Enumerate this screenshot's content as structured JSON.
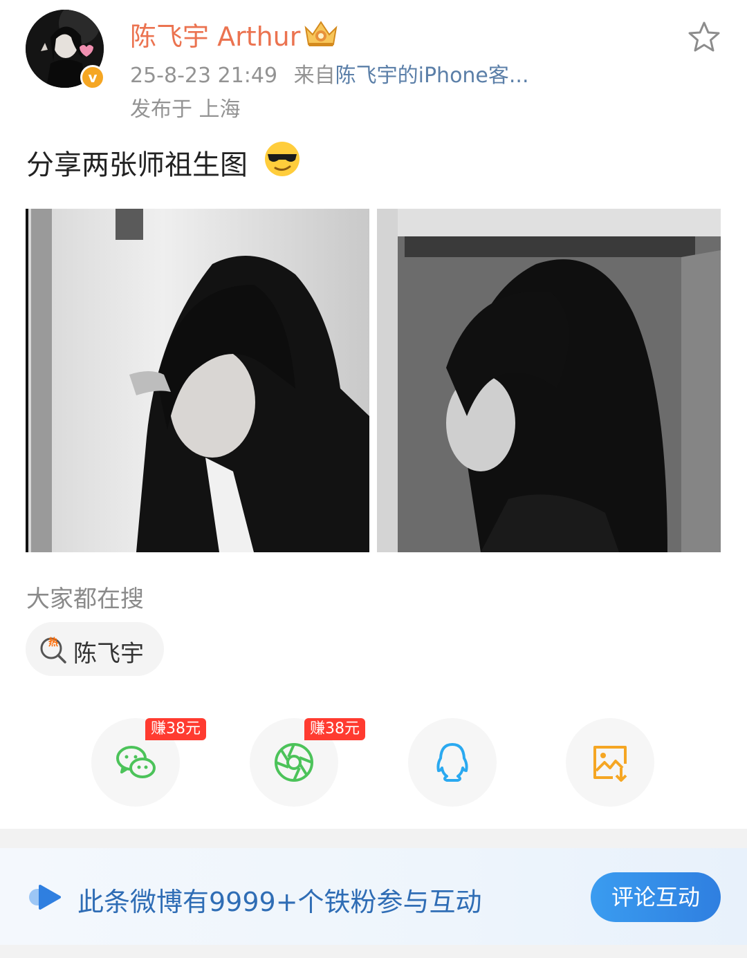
{
  "post": {
    "author": "陈飞宇 Arthur",
    "timestamp": "25-8-23 21:49",
    "source_prefix": "来自",
    "source": "陈飞宇的iPhone客...",
    "location": "发布于 上海",
    "text": "分享两张师祖生图",
    "emoji": "sunglasses-emoji",
    "images": [
      "photo-1",
      "photo-2"
    ]
  },
  "search": {
    "title": "大家都在搜",
    "chip_label": "陈飞宇",
    "chip_icon": "hot-search-icon"
  },
  "share": {
    "reward_label": "赚38元",
    "buttons": [
      {
        "icon": "wechat-icon",
        "color": "#4cc35a"
      },
      {
        "icon": "moments-icon",
        "color": "#4cc35a"
      },
      {
        "icon": "qq-icon",
        "color": "#2aa9f0"
      },
      {
        "icon": "save-image-icon",
        "color": "#f5a623"
      }
    ]
  },
  "banner": {
    "text": "此条微博有9999+个铁粉参与互动",
    "button": "评论互动"
  },
  "colors": {
    "username": "#eb7350",
    "meta": "#939393",
    "source_link": "#5b7fa8",
    "banner_text": "#2f6db5",
    "accent_blue": "#2f7fe0",
    "reward_red": "#ff3b30"
  }
}
